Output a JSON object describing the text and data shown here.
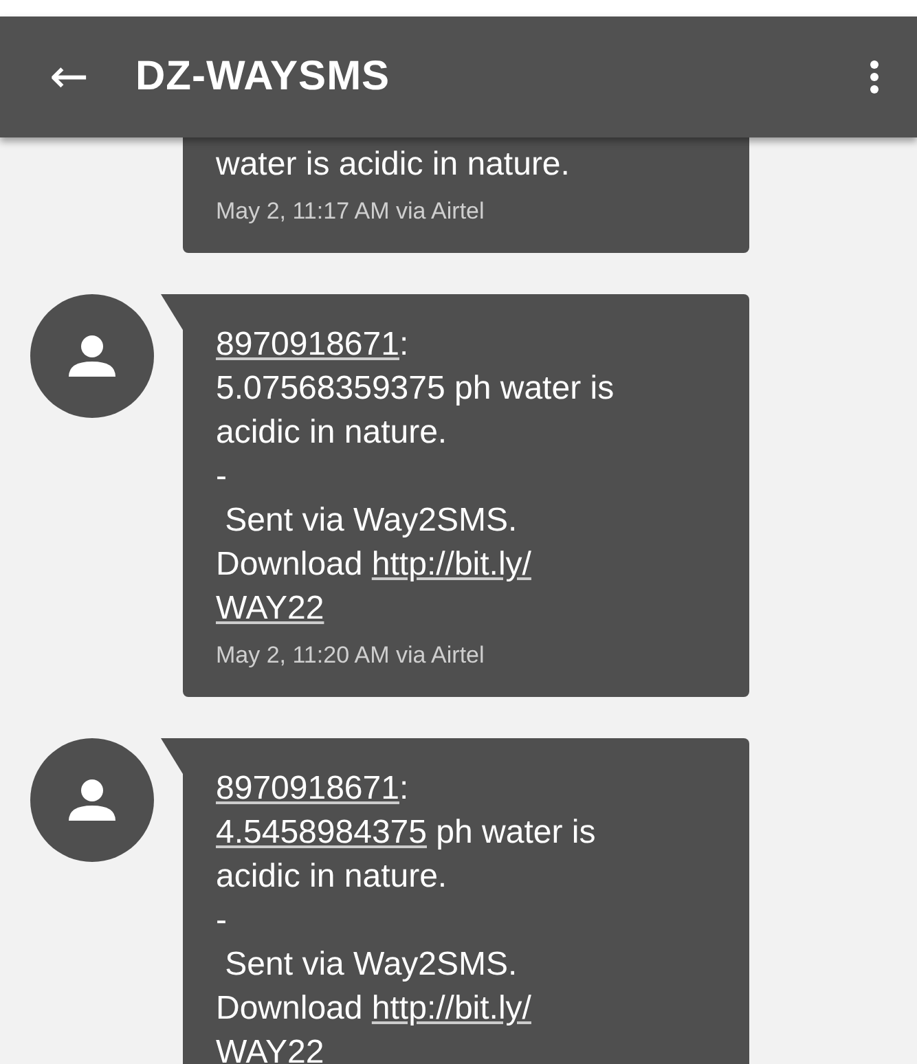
{
  "toolbar": {
    "back": "←",
    "title": "DZ-WAYSMS"
  },
  "messages": [
    {
      "kind": "partial",
      "lines": [
        "water is acidic in nature."
      ],
      "meta": "May 2, 11:17 AM via Airtel"
    },
    {
      "kind": "full",
      "sender": "8970918671",
      "separator": ":",
      "value": "5.07568359375",
      "value_linked": false,
      "text": " ph water is acidic in nature.",
      "dash": "-",
      "footer": " Sent via Way2SMS.",
      "download": "Download",
      "link_parts": [
        "http://bit.ly/",
        "WAY22"
      ],
      "meta": "May 2, 11:20 AM via Airtel"
    },
    {
      "kind": "full",
      "sender": "8970918671",
      "separator": ":",
      "value": "4.5458984375",
      "value_linked": true,
      "text": " ph water is acidic in nature.",
      "dash": "-",
      "footer": " Sent via Way2SMS.",
      "download": "Download",
      "link_parts": [
        "http://bit.ly/",
        "WAY22"
      ]
    }
  ]
}
